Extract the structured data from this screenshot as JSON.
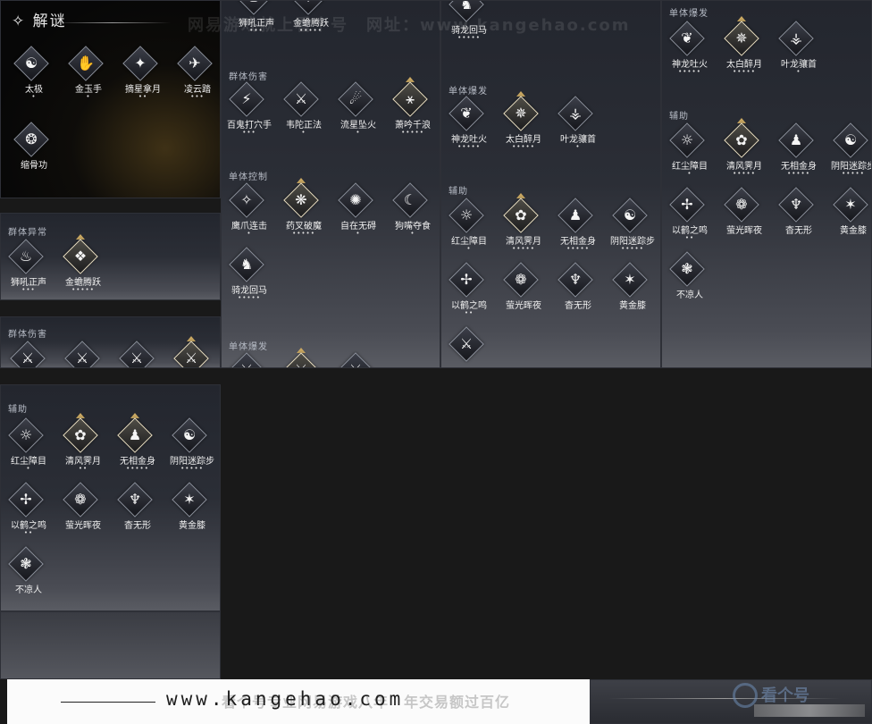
{
  "page_title": "✧ 解谜",
  "watermark_top": "网易游戏就上看个号　网址：www.kangehao.com",
  "footer": {
    "url": "www.kangehao.com",
    "slogan": "看个号专业网易游戏八年　年交易额过百亿"
  },
  "logo": {
    "text": "看个号"
  },
  "icons": {
    "太极": "☯",
    "金玉手": "✋",
    "摘星拿月": "✦",
    "凌云踏": "✈",
    "缩骨功": "❂",
    "狮吼正声": "♨",
    "金蟾腾跃": "❖",
    "百鬼打穴手": "⚡",
    "韦陀正法": "⚔",
    "流星坠火": "☄",
    "萧吟千浪": "⚹",
    "鹰爪连击": "✧",
    "药叉破魔": "❋",
    "自在无碍": "✺",
    "狗嘴夺食": "☾",
    "骑龙回马": "♞",
    "神龙吐火": "❦",
    "太白醉月": "✵",
    "叶龙骧首": "⚶",
    "红尘障目": "☼",
    "清风霁月": "✿",
    "无相金身": "♟",
    "阴阳迷踪步": "☯",
    "以鹤之鸣": "✢",
    "萤光晖夜": "❁",
    "杳无形": "♆",
    "黄金膝": "✶",
    "不凉人": "❃"
  },
  "panels": [
    {
      "id": "p1",
      "sections": [
        {
          "title": "",
          "skills": [
            {
              "name": "太极",
              "dots": "•"
            },
            {
              "name": "金玉手",
              "dots": "•"
            },
            {
              "name": "摘星拿月",
              "dots": "••"
            },
            {
              "name": "凌云踏",
              "dots": "•••"
            },
            {
              "name": "缩骨功",
              "dots": ""
            }
          ]
        }
      ]
    },
    {
      "id": "p2",
      "sections": [
        {
          "title": "群体异常",
          "skills": [
            {
              "name": "狮吼正声",
              "dots": "•••"
            },
            {
              "name": "金蟾腾跃",
              "dots": "•••••"
            }
          ]
        }
      ]
    },
    {
      "id": "p3",
      "sections": [
        {
          "title": "群体伤害",
          "skills": [
            {
              "name": "",
              "dots": "•••••"
            },
            {
              "name": "",
              "dots": "•••••"
            },
            {
              "name": "",
              "dots": "•"
            },
            {
              "name": "",
              "dots": ""
            }
          ]
        }
      ]
    },
    {
      "id": "p4",
      "sections": [
        {
          "title": "辅助",
          "skills": [
            {
              "name": "红尘障目",
              "dots": "•"
            },
            {
              "name": "清风霁月",
              "dots": "••"
            },
            {
              "name": "无相金身",
              "dots": "•••••"
            },
            {
              "name": "阴阳迷踪步",
              "dots": "•••••"
            },
            {
              "name": "以鹤之鸣",
              "dots": "••"
            },
            {
              "name": "萤光晖夜",
              "dots": ""
            },
            {
              "name": "杳无形",
              "dots": ""
            },
            {
              "name": "黄金膝",
              "dots": ""
            },
            {
              "name": "不凉人",
              "dots": ""
            }
          ]
        }
      ]
    },
    {
      "id": "p5",
      "sections": [
        {
          "title": "",
          "skills": [
            {
              "name": "狮吼正声",
              "dots": "•••"
            },
            {
              "name": "金蟾腾跃",
              "dots": "•••••"
            }
          ]
        },
        {
          "title": "群体伤害",
          "skills": [
            {
              "name": "百鬼打穴手",
              "dots": "•••"
            },
            {
              "name": "韦陀正法",
              "dots": "•"
            },
            {
              "name": "流星坠火",
              "dots": "•"
            },
            {
              "name": "萧吟千浪",
              "dots": "•••••"
            }
          ]
        },
        {
          "title": "单体控制",
          "skills": [
            {
              "name": "鹰爪连击",
              "dots": "•"
            },
            {
              "name": "药叉破魔",
              "dots": "•••••"
            },
            {
              "name": "自在无碍",
              "dots": "•"
            },
            {
              "name": "狗嘴夺食",
              "dots": "•"
            },
            {
              "name": "骑龙回马",
              "dots": "•••••"
            }
          ]
        },
        {
          "title": "单体爆发",
          "skills": [
            {
              "name": "",
              "dots": ""
            },
            {
              "name": "",
              "dots": ""
            },
            {
              "name": "",
              "dots": ""
            }
          ]
        }
      ]
    },
    {
      "id": "p6",
      "sections": [
        {
          "title": "",
          "skills": [
            {
              "name": "骑龙回马",
              "dots": "•••••"
            }
          ]
        },
        {
          "title": "单体爆发",
          "skills": [
            {
              "name": "神龙吐火",
              "dots": "•••••"
            },
            {
              "name": "太白醉月",
              "dots": "•••••"
            },
            {
              "name": "叶龙骧首",
              "dots": "•"
            }
          ]
        },
        {
          "title": "辅助",
          "skills": [
            {
              "name": "红尘障目",
              "dots": "•"
            },
            {
              "name": "清风霁月",
              "dots": "•••••"
            },
            {
              "name": "无相金身",
              "dots": "•••••"
            },
            {
              "name": "阴阳迷踪步",
              "dots": "•••••"
            },
            {
              "name": "以鹤之鸣",
              "dots": "••"
            },
            {
              "name": "萤光晖夜",
              "dots": ""
            },
            {
              "name": "杳无形",
              "dots": ""
            },
            {
              "name": "黄金膝",
              "dots": ""
            },
            {
              "name": "",
              "dots": ""
            }
          ]
        }
      ]
    },
    {
      "id": "p7",
      "sections": [
        {
          "title": "单体爆发",
          "skills": [
            {
              "name": "神龙吐火",
              "dots": "•••••"
            },
            {
              "name": "太白醉月",
              "dots": "•••••"
            },
            {
              "name": "叶龙骧首",
              "dots": "•"
            }
          ]
        },
        {
          "title": "辅助",
          "skills": [
            {
              "name": "红尘障目",
              "dots": "•"
            },
            {
              "name": "清风霁月",
              "dots": "•••••"
            },
            {
              "name": "无相金身",
              "dots": "•••••"
            },
            {
              "name": "阴阳迷踪步",
              "dots": "•••••"
            },
            {
              "name": "以鹤之鸣",
              "dots": "••"
            },
            {
              "name": "萤光晖夜",
              "dots": ""
            },
            {
              "name": "杳无形",
              "dots": ""
            },
            {
              "name": "黄金膝",
              "dots": ""
            },
            {
              "name": "不凉人",
              "dots": ""
            }
          ]
        }
      ]
    }
  ]
}
